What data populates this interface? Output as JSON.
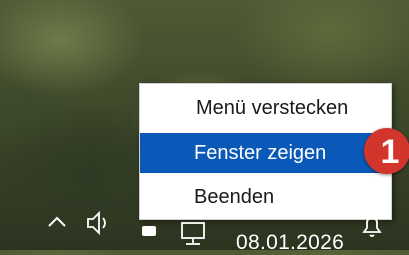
{
  "context_menu": {
    "items": [
      {
        "label": "Menü verstecken",
        "selected": false
      },
      {
        "label": "Fenster zeigen",
        "selected": true
      },
      {
        "label": "Beenden",
        "selected": false
      }
    ]
  },
  "annotation_badge": {
    "number": "1",
    "color": "#d2352b"
  },
  "taskbar": {
    "date": "08.01.2026",
    "icons": [
      "chevron-up-icon",
      "speaker-icon",
      "app-tray-icon",
      "network-icon",
      "notification-icon"
    ]
  },
  "colors": {
    "selection": "#0a59b8",
    "menu_bg": "#ffffff"
  }
}
